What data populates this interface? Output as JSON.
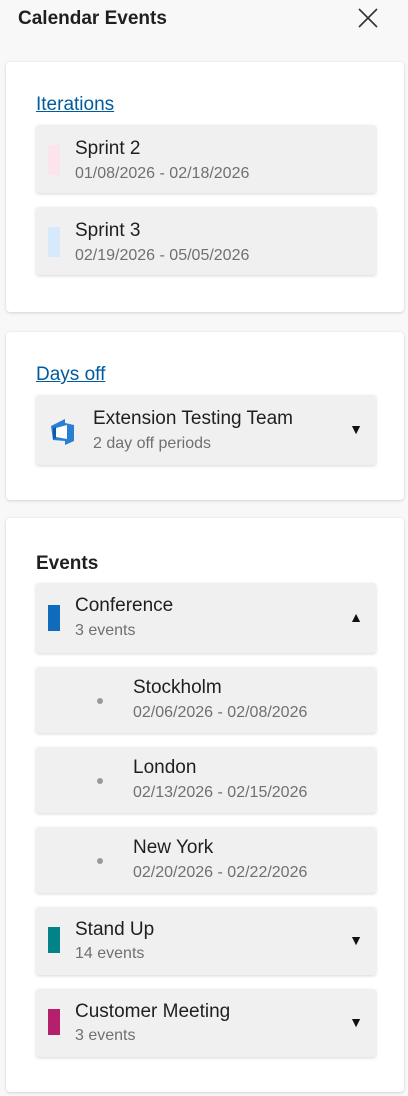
{
  "header": {
    "title": "Calendar Events"
  },
  "iterations": {
    "heading": "Iterations",
    "items": [
      {
        "name": "Sprint 2",
        "dates": "01/08/2026 - 02/18/2026",
        "color": "#fce4ec"
      },
      {
        "name": "Sprint 3",
        "dates": "02/19/2026 - 05/05/2026",
        "color": "#d6eafb"
      }
    ]
  },
  "days_off": {
    "heading": "Days off",
    "team": {
      "name": "Extension Testing Team",
      "summary": "2 day off periods",
      "icon": "azure-devops-icon",
      "expanded": false
    }
  },
  "events": {
    "heading": "Events",
    "groups": [
      {
        "name": "Conference",
        "summary": "3 events",
        "color": "#0f6cbd",
        "expanded": true,
        "items": [
          {
            "name": "Stockholm",
            "dates": "02/06/2026 - 02/08/2026"
          },
          {
            "name": "London",
            "dates": "02/13/2026 - 02/15/2026"
          },
          {
            "name": "New York",
            "dates": "02/20/2026 - 02/22/2026"
          }
        ]
      },
      {
        "name": "Stand Up",
        "summary": "14 events",
        "color": "#038387",
        "expanded": false
      },
      {
        "name": "Customer Meeting",
        "summary": "3 events",
        "color": "#b4206b",
        "expanded": false
      }
    ]
  },
  "icons": {
    "expand": "chevron-down-icon",
    "collapse": "chevron-up-icon",
    "close": "close-icon"
  }
}
